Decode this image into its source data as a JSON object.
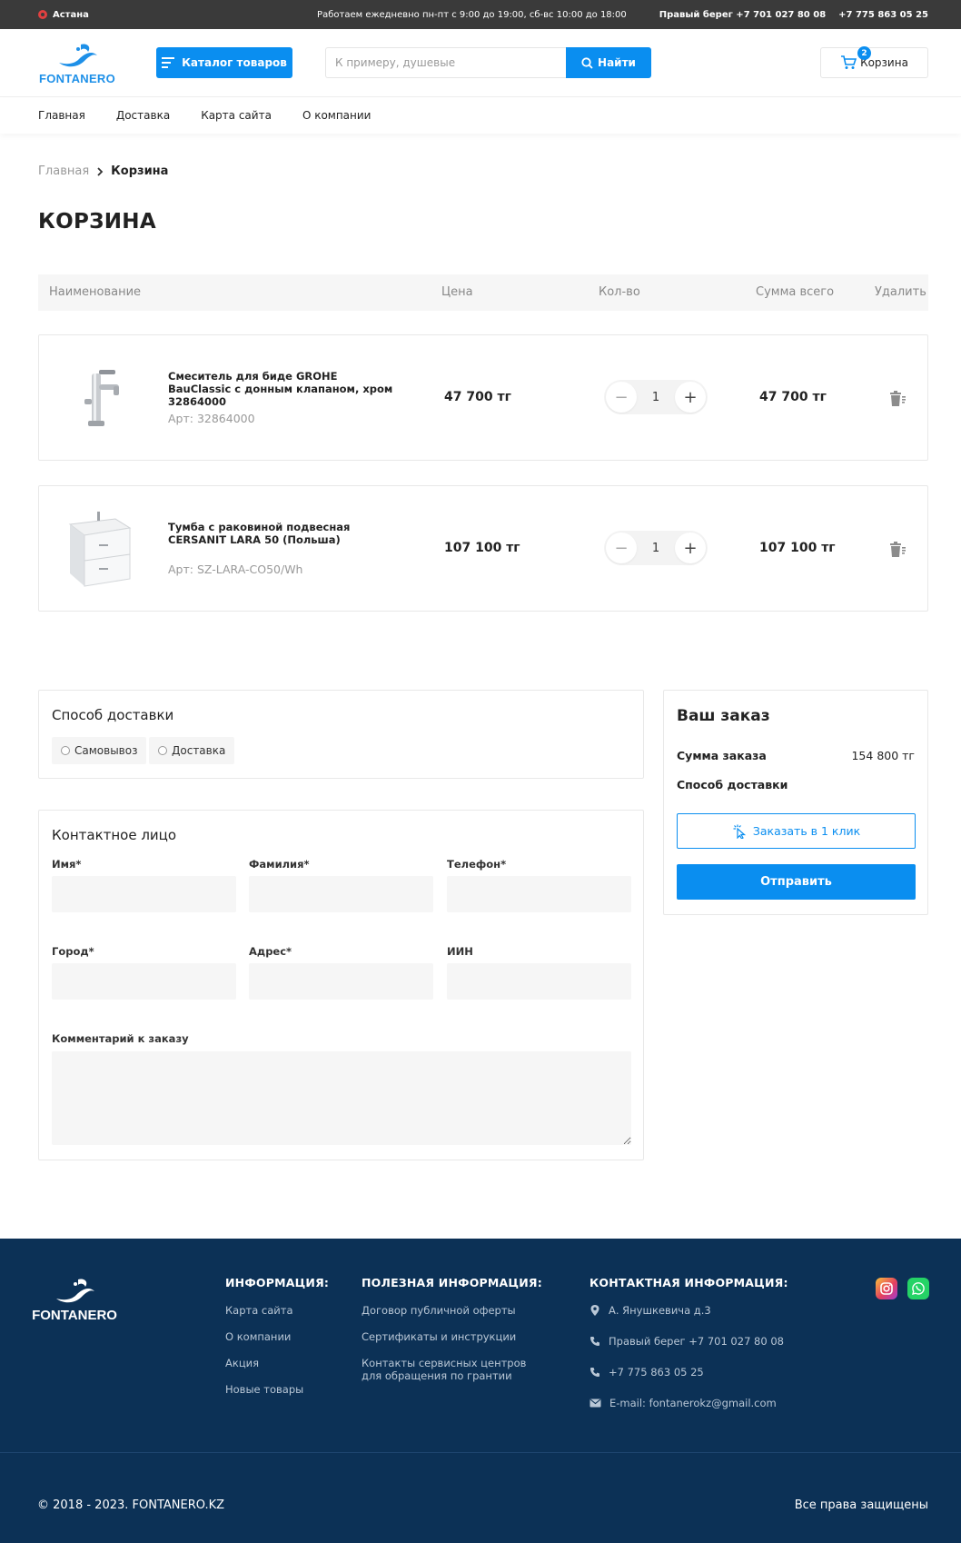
{
  "topbar": {
    "city": "Астана",
    "hours": "Работаем ежедневно пн-пт с 9:00 до 19:00, сб-вс 10:00 до 18:00",
    "phone1": "Правый берег +7 701 027 80 08",
    "phone2": "+7 775 863 05 25"
  },
  "header": {
    "logo_text": "FONTANERO",
    "catalog_label": "Каталог товаров",
    "search_placeholder": "К примеру, душевые",
    "search_button": "Найти",
    "cart_label": "Корзина",
    "cart_count": "2"
  },
  "nav": [
    "Главная",
    "Доставка",
    "Карта сайта",
    "О компании"
  ],
  "breadcrumb": {
    "home": "Главная",
    "current": "Корзина"
  },
  "page_title": "КОРЗИНА",
  "table_headers": {
    "name": "Наименование",
    "price": "Цена",
    "qty": "Кол-во",
    "total": "Сумма всего",
    "delete": "Удалить"
  },
  "cart_items": [
    {
      "name": "Смеситель для биде GROHE BauClassic с донным клапаном, хром 32864000",
      "sku": "Арт: 32864000",
      "price": "47 700 тг",
      "qty": "1",
      "total": "47 700 тг"
    },
    {
      "name": "Тумба с раковиной подвесная CERSANIT LARA 50 (Польша)",
      "sku": "Арт: SZ-LARA-CO50/Wh",
      "price": "107 100 тг",
      "qty": "1",
      "total": "107 100 тг"
    }
  ],
  "delivery": {
    "title": "Способ доставки",
    "options": [
      "Самовывоз",
      "Доставка"
    ]
  },
  "contact": {
    "title": "Контактное лицо",
    "labels": {
      "first_name": "Имя*",
      "last_name": "Фамилия*",
      "phone": "Телефон*",
      "city": "Город*",
      "address": "Адрес*",
      "iin": "ИИН",
      "comment": "Комментарий к заказу"
    }
  },
  "order": {
    "title": "Ваш заказ",
    "sum_label": "Сумма заказа",
    "sum_value": "154 800 тг",
    "delivery_label": "Способ доставки",
    "one_click": "Заказать в 1 клик",
    "submit": "Отправить"
  },
  "footer": {
    "logo_text": "FONTANERO",
    "info_title": "ИНФОРМАЦИЯ:",
    "info_links": [
      "Карта сайта",
      "О компании",
      "Акция",
      "Новые товары"
    ],
    "useful_title": "ПОЛЕЗНАЯ ИНФОРМАЦИЯ:",
    "useful_links": [
      "Договор публичной оферты",
      "Сертификаты и инструкции",
      "Контакты сервисных центров для обращения по грантии"
    ],
    "contact_title": "КОНТАКТНАЯ ИНФОРМАЦИЯ:",
    "address": "А. Янушкевича д.3",
    "phone1": "Правый берег +7 701 027 80 08",
    "phone2": "+7 775 863 05 25",
    "email": "E-mail: fontanerokz@gmail.com",
    "copyright": "© 2018 - 2023. FONTANERO.KZ",
    "rights": "Все права защищены"
  },
  "colors": {
    "accent": "#0a8ef0",
    "topbar": "#3a3a3a",
    "footer": "#0c3156",
    "instagram": "#e4405f",
    "whatsapp": "#25d366"
  },
  "icons": [
    "location-pin-icon",
    "menu-icon",
    "search-icon",
    "cart-icon",
    "trash-icon",
    "cursor-click-icon",
    "phone-icon",
    "mail-icon",
    "instagram-icon",
    "whatsapp-icon"
  ]
}
